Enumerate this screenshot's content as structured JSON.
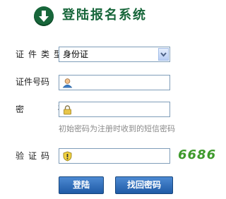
{
  "header": {
    "title": "登陆报名系统",
    "icon": "down-arrow-icon",
    "accent_color": "#17663a"
  },
  "form": {
    "id_type": {
      "label": "证件类型",
      "selected": "身份证"
    },
    "id_number": {
      "label": "证件号码",
      "value": "",
      "icon": "user-icon"
    },
    "password": {
      "label": "密　码",
      "value": "",
      "icon": "lock-icon",
      "hint": "初始密码为注册时收到的短信密码"
    },
    "captcha": {
      "label": "验证码",
      "value": "",
      "icon": "captcha-shield-icon",
      "image_text": "6686"
    }
  },
  "buttons": {
    "login_label": "登陆",
    "recover_label": "找回密码",
    "color": "#1f5ba6"
  }
}
